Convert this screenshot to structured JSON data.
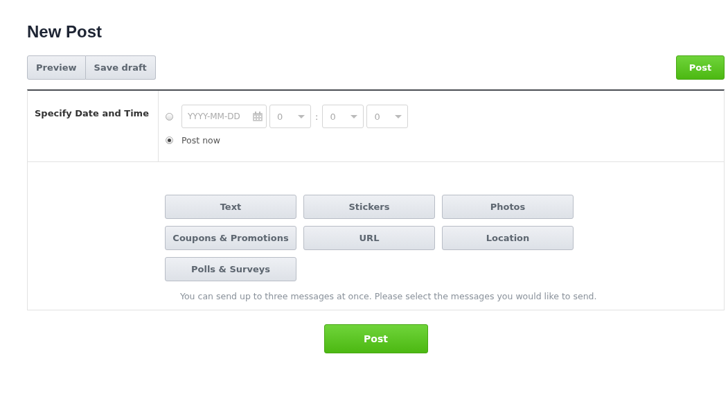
{
  "page_title": "New Post",
  "toolbar": {
    "buttons": [
      "Preview",
      "Save draft"
    ],
    "post_button": "Post"
  },
  "schedule": {
    "label": "Specify Date and Time",
    "options": [
      {
        "kind": "datetime",
        "selected": false,
        "date_placeholder": "YYYY-MM-DD",
        "hour": "0",
        "separator": ":",
        "minute": "0",
        "second": "0"
      },
      {
        "kind": "now",
        "selected": true,
        "label": "Post now"
      }
    ]
  },
  "message_types": [
    "Text",
    "Stickers",
    "Photos",
    "Coupons & Promotions",
    "URL",
    "Location",
    "Polls & Surveys"
  ],
  "hint": "You can send up to three messages at once. Please select the messages you would like to send.",
  "footer_button": "Post"
}
